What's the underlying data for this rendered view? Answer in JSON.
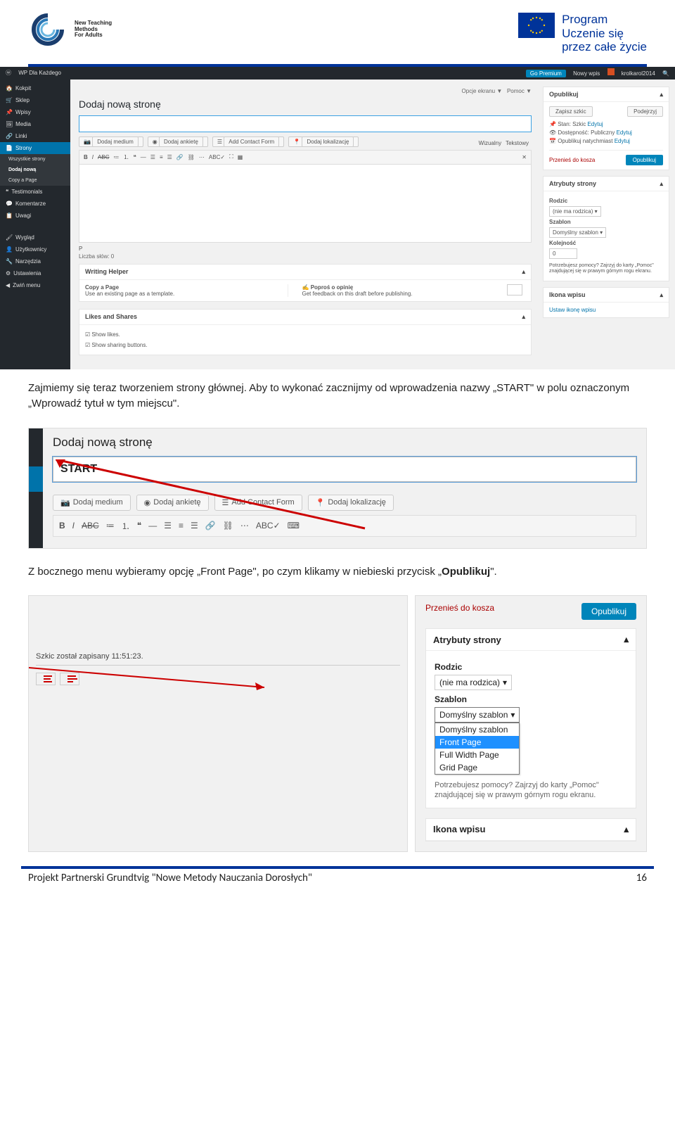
{
  "header": {
    "logo_line1": "New Teaching",
    "logo_line2": "Methods",
    "logo_line3": "For Adults",
    "eu_line1": "Program",
    "eu_line2": "Uczenie się",
    "eu_line3": "przez całe życie"
  },
  "wp": {
    "topbar": {
      "site": "WP Dla Każdego",
      "premium": "Go Premium",
      "new": "Nowy wpis",
      "user": "krolkarol2014"
    },
    "screen_opts": {
      "left": "Opcje ekranu",
      "right": "Pomoc"
    },
    "sidebar": {
      "kokpit": "Kokpit",
      "sklep": "Sklep",
      "wpisy": "Wpisy",
      "media": "Media",
      "linki": "Linki",
      "strony": "Strony",
      "wszystkie": "Wszystkie strony",
      "dodaj": "Dodaj nową",
      "copy": "Copy a Page",
      "testimonials": "Testimonials",
      "komentarze": "Komentarze",
      "uwagi": "Uwagi",
      "wyglad": "Wygląd",
      "uzytkownicy": "Użytkownicy",
      "narzedzia": "Narzędzia",
      "ustawienia": "Ustawienia",
      "zwin": "Zwiń menu"
    },
    "main": {
      "title": "Dodaj nową stronę",
      "media_btn1": "Dodaj medium",
      "media_btn2": "Dodaj ankietę",
      "media_btn3": "Add Contact Form",
      "media_btn4": "Dodaj lokalizację",
      "tab1": "Wizualny",
      "tab2": "Tekstowy",
      "p_label": "P",
      "words": "Liczba słów: 0",
      "writing_helper": "Writing Helper",
      "copy_page": "Copy a Page",
      "copy_desc": "Use an existing page as a template.",
      "opinion_title": "Poproś o opinię",
      "opinion_desc": "Get feedback on this draft before publishing.",
      "likes_head": "Likes and Shares",
      "show_likes": "Show likes.",
      "show_sharing": "Show sharing buttons."
    },
    "publish": {
      "head": "Opublikuj",
      "save": "Zapisz szkic",
      "preview": "Podejrzyj",
      "status_lbl": "Stan: Szkic",
      "status_edit": "Edytuj",
      "visibility": "Dostępność: Publiczny",
      "visibility_edit": "Edytuj",
      "natychmiast": "Opublikuj natychmiast",
      "natychmiast_edit": "Edytuj",
      "trash": "Przenieś do kosza",
      "pub_btn": "Opublikuj"
    },
    "attrs": {
      "head": "Atrybuty strony",
      "rodzic": "Rodzic",
      "rodzic_val": "(nie ma rodzica)",
      "szablon": "Szablon",
      "szablon_val": "Domyślny szablon",
      "kolejnosc": "Kolejność",
      "kolejnosc_val": "0",
      "help": "Potrzebujesz pomocy? Zajrzyj do karty „Pomoc\" znajdującej się w prawym górnym rogu ekranu."
    },
    "ikona": {
      "head": "Ikona wpisu",
      "link": "Ustaw ikonę wpisu"
    }
  },
  "para1": "Zajmiemy się teraz tworzeniem strony głównej. Aby to wykonać zacznijmy od wprowadzenia nazwy „START\" w polu oznaczonym „Wprowadź tytuł w tym miejscu\".",
  "shot2": {
    "title": "Dodaj nową stronę",
    "value": "START",
    "btn1": "Dodaj medium",
    "btn2": "Dodaj ankietę",
    "btn3": "Add Contact Form",
    "btn4": "Dodaj lokalizację"
  },
  "para2_a": "Z bocznego menu wybieramy opcję „Front Page\", po czym klikamy w niebieski przycisk „",
  "para2_b": "Opublikuj",
  "para2_c": "\".",
  "shot3": {
    "trash": "Przenieś do kosza",
    "pub": "Opublikuj",
    "attr_head": "Atrybuty strony",
    "rodzic": "Rodzic",
    "rodzic_val": "(nie ma rodzica)",
    "szablon": "Szablon",
    "sel_shown": "Domyślny szablon",
    "opt1": "Domyślny szablon",
    "opt2": "Front Page",
    "opt3": "Full Width Page",
    "opt4": "Grid Page",
    "help": "Potrzebujesz pomocy? Zajrzyj do karty „Pomoc\" znajdującej się w prawym górnym rogu ekranu.",
    "saved": "Szkic został zapisany 11:51:23.",
    "ikona_head": "Ikona wpisu"
  },
  "footer": {
    "text": "Projekt Partnerski Grundtvig \"Nowe Metody Nauczania Dorosłych\"",
    "page": "16"
  }
}
